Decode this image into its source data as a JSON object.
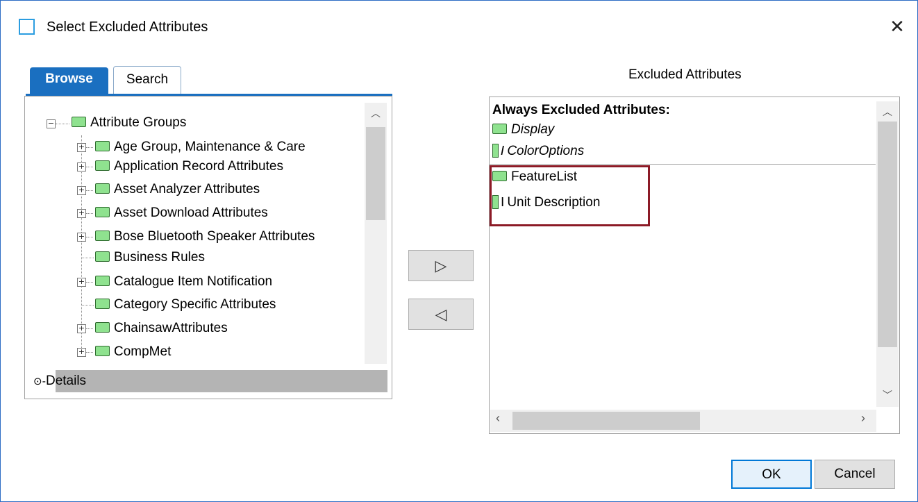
{
  "dialog": {
    "title": "Select Excluded Attributes",
    "close_glyph": "✕"
  },
  "tabs": [
    {
      "label": "Browse",
      "active": true
    },
    {
      "label": "Search",
      "active": false
    }
  ],
  "tree": {
    "root": "Attribute Groups",
    "items": [
      {
        "label": "Age Group, Maintenance & Care",
        "expandable": true
      },
      {
        "label": "Application Record Attributes",
        "expandable": true
      },
      {
        "label": "Asset Analyzer Attributes",
        "expandable": true
      },
      {
        "label": "Asset Download Attributes",
        "expandable": true
      },
      {
        "label": "Bose Bluetooth Speaker Attributes",
        "expandable": true
      },
      {
        "label": "Business Rules",
        "expandable": false
      },
      {
        "label": "Catalogue Item Notification",
        "expandable": true
      },
      {
        "label": "Category Specific Attributes",
        "expandable": false
      },
      {
        "label": "ChainsawAttributes",
        "expandable": true
      },
      {
        "label": "CompMet",
        "expandable": true
      }
    ]
  },
  "details": {
    "label": "Details"
  },
  "move_buttons": {
    "add_glyph": "▷",
    "remove_glyph": "◁"
  },
  "excluded": {
    "title": "Excluded Attributes",
    "always_header": "Always Excluded Attributes:",
    "always_items": [
      {
        "label": "Display",
        "icon": "folder-icon"
      },
      {
        "label": "ColorOptions",
        "icon": "attribute-icon"
      }
    ],
    "items": [
      {
        "label": "FeatureList",
        "icon": "folder-icon"
      },
      {
        "label": "Unit Description",
        "icon": "attribute-icon"
      }
    ],
    "highlight_color": "#8c1a26"
  },
  "buttons": {
    "ok": "OK",
    "cancel": "Cancel"
  },
  "colors": {
    "accent": "#1a6fc0",
    "folder_fill": "#8fe28f"
  }
}
